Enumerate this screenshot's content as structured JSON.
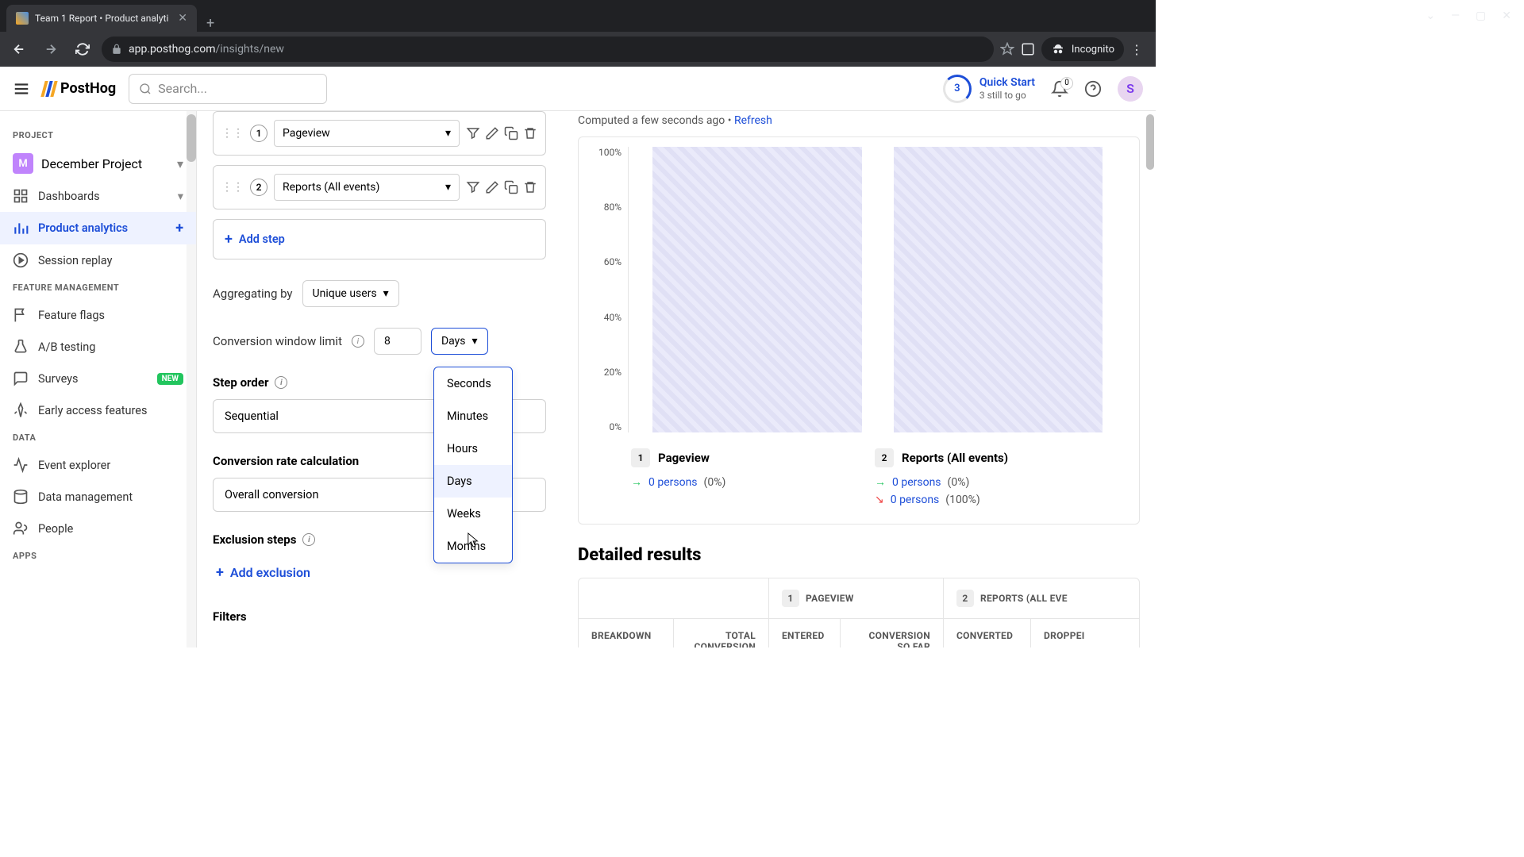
{
  "browser": {
    "tab_title": "Team 1 Report • Product analyti",
    "url_domain": "app.posthog.com",
    "url_path": "/insights/new",
    "incognito_label": "Incognito"
  },
  "header": {
    "logo_text": "PostHog",
    "search_placeholder": "Search...",
    "quick_start": {
      "ring_value": "3",
      "title": "Quick Start",
      "subtitle": "3 still to go"
    },
    "notif_count": "0",
    "avatar_initial": "S"
  },
  "sidebar": {
    "sections": {
      "project": "PROJECT",
      "feature": "FEATURE MANAGEMENT",
      "data": "DATA",
      "apps": "APPS"
    },
    "project": {
      "badge": "M",
      "name": "December Project"
    },
    "items": {
      "dashboards": "Dashboards",
      "product_analytics": "Product analytics",
      "session_replay": "Session replay",
      "feature_flags": "Feature flags",
      "ab_testing": "A/B testing",
      "surveys": "Surveys",
      "early_access": "Early access features",
      "event_explorer": "Event explorer",
      "data_management": "Data management",
      "people": "People"
    },
    "new_badge": "NEW"
  },
  "config": {
    "steps": [
      {
        "num": "1",
        "label": "Pageview"
      },
      {
        "num": "2",
        "label": "Reports (All events)"
      }
    ],
    "add_step": "Add step",
    "aggregating_label": "Aggregating by",
    "aggregating_value": "Unique users",
    "conversion_label": "Conversion window limit",
    "conversion_value": "8",
    "conversion_unit": "Days",
    "unit_options": [
      "Seconds",
      "Minutes",
      "Hours",
      "Days",
      "Weeks",
      "Months"
    ],
    "step_order_label": "Step order",
    "step_order_value": "Sequential",
    "conv_rate_label": "Conversion rate calculation",
    "conv_rate_value": "Overall conversion",
    "exclusion_label": "Exclusion steps",
    "add_exclusion": "Add exclusion",
    "filters_label": "Filters"
  },
  "results": {
    "computed_text": "Computed a few seconds ago",
    "reload": "Refresh",
    "detailed_heading": "Detailed results",
    "legend": [
      {
        "num": "1",
        "title": "Pageview",
        "stats": [
          {
            "dir": "right",
            "persons": "0 persons",
            "pct": "(0%)"
          }
        ]
      },
      {
        "num": "2",
        "title": "Reports (All events)",
        "stats": [
          {
            "dir": "right",
            "persons": "0 persons",
            "pct": "(0%)"
          },
          {
            "dir": "down",
            "persons": "0 persons",
            "pct": "(100%)"
          }
        ]
      }
    ],
    "table": {
      "group1": {
        "num": "1",
        "label": "PAGEVIEW"
      },
      "group2": {
        "num": "2",
        "label": "REPORTS (ALL EVE"
      },
      "cols": [
        "BREAKDOWN",
        "TOTAL CONVERSION",
        "ENTERED",
        "CONVERSION SO FAR",
        "CONVERTED",
        "DROPPEI"
      ]
    }
  },
  "chart_data": {
    "type": "bar",
    "categories": [
      "Pageview",
      "Reports (All events)"
    ],
    "values": [
      100,
      100
    ],
    "ylabel": "",
    "ylim": [
      0,
      100
    ],
    "y_ticks": [
      "100%",
      "80%",
      "60%",
      "40%",
      "20%",
      "0%"
    ]
  }
}
